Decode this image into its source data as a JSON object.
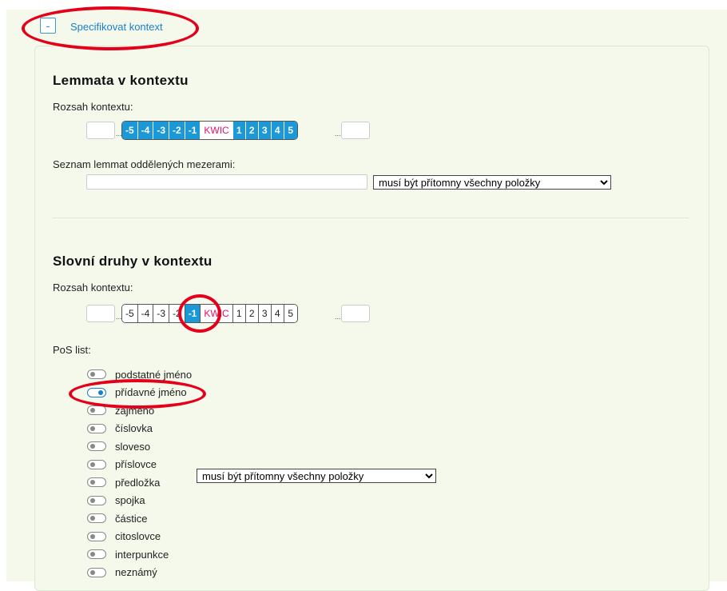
{
  "toggle": {
    "symbol": "-",
    "label": "Specifikovat kontext"
  },
  "lemma": {
    "heading": "Lemmata v kontextu",
    "range_label": "Rozsah kontextu:",
    "dots": "...",
    "cells": [
      "-5",
      "-4",
      "-3",
      "-2",
      "-1",
      "KWIC",
      "1",
      "2",
      "3",
      "4",
      "5"
    ],
    "list_label": "Seznam lemmat oddělených mezerami:",
    "list_value": "",
    "condition": "musí být přítomny všechny položky"
  },
  "pos": {
    "heading": "Slovní druhy v kontextu",
    "range_label": "Rozsah kontextu:",
    "dots": "...",
    "cells": [
      "-5",
      "-4",
      "-3",
      "-2",
      "-1",
      "KWIC",
      "1",
      "2",
      "3",
      "4",
      "5"
    ],
    "selected_cell": "-1",
    "list_label": "PoS list:",
    "items": [
      {
        "label": "podstatné jméno",
        "checked": false
      },
      {
        "label": "přídavné jméno",
        "checked": true
      },
      {
        "label": "zájmeno",
        "checked": false
      },
      {
        "label": "číslovka",
        "checked": false
      },
      {
        "label": "sloveso",
        "checked": false
      },
      {
        "label": "příslovce",
        "checked": false
      },
      {
        "label": "předložka",
        "checked": false
      },
      {
        "label": "spojka",
        "checked": false
      },
      {
        "label": "částice",
        "checked": false
      },
      {
        "label": "citoslovce",
        "checked": false
      },
      {
        "label": "interpunkce",
        "checked": false
      },
      {
        "label": "neznámý",
        "checked": false
      }
    ],
    "condition": "musí být přítomny všechny položky"
  },
  "colors": {
    "accent": "#1a98d8",
    "kwic": "#e0126a",
    "annotation": "#e4001b",
    "background": "#f4f9ec"
  }
}
